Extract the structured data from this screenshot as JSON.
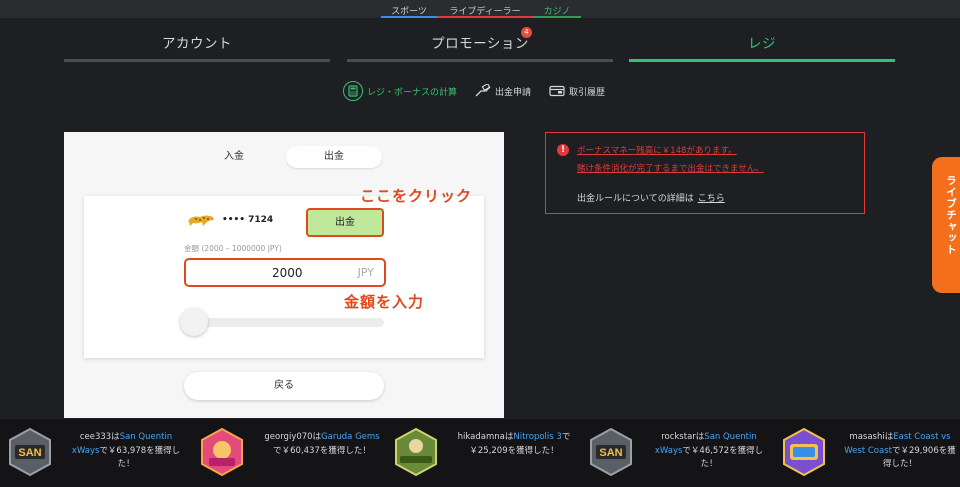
{
  "top_tabs": {
    "sports": "スポーツ",
    "live_dealer": "ライブディーラー",
    "casino": "カジノ"
  },
  "main_nav": {
    "account": "アカウント",
    "promotion": "プロモーション",
    "promotion_badge": "4",
    "cashier": "レジ"
  },
  "sub_nav": {
    "bonus_calc": "レジ・ボーナスの計算",
    "withdraw_request": "出金申請",
    "history": "取引履歴"
  },
  "panel": {
    "deposit_tab": "入金",
    "withdraw_tab": "出金",
    "card_number": "•••• 7124",
    "withdraw_button": "出金",
    "click_note": "ここをクリック",
    "amount_label": "金額 (2000 – 1000000 JPY)",
    "amount_value": "2000",
    "amount_unit": "JPY",
    "input_note": "金額を入力",
    "slider_level": 0,
    "back_button": "戻る"
  },
  "warning": {
    "line1": "ボーナスマネー残高に￥148があります。",
    "line2": "賭け条件消化が完了するまで出金はできません。",
    "line3": "出金ルールについての詳細は",
    "link": "こちら"
  },
  "live_chat": "ライブチャット",
  "ticker": [
    {
      "user": "cee333",
      "mid": "は",
      "game": "San Quentin xWays",
      "tail": "で￥63,978を獲得した！",
      "icon": "san-quentin-icon"
    },
    {
      "user": "georgiy070",
      "mid": "は",
      "game": "Garuda Gems",
      "tail": "で￥60,437を獲得した！",
      "icon": "garuda-gems-icon"
    },
    {
      "user": "hikadamna",
      "mid": "は",
      "game": "Nitropolis 3",
      "tail": "で￥25,209を獲得した！",
      "icon": "nitropolis-icon"
    },
    {
      "user": "rockstar",
      "mid": "は",
      "game": "San Quentin xWays",
      "tail": "で￥46,572を獲得した！",
      "icon": "san-quentin-icon"
    },
    {
      "user": "masashi",
      "mid": "は",
      "game": "East Coast vs West Coast",
      "tail": "で￥29,906を獲得した！",
      "icon": "east-west-coast-icon"
    }
  ],
  "colors": {
    "accent_green": "#37c171",
    "highlight_orange": "#e0491c",
    "warning_red": "#e23a3a",
    "chat_orange": "#f46f1c"
  }
}
